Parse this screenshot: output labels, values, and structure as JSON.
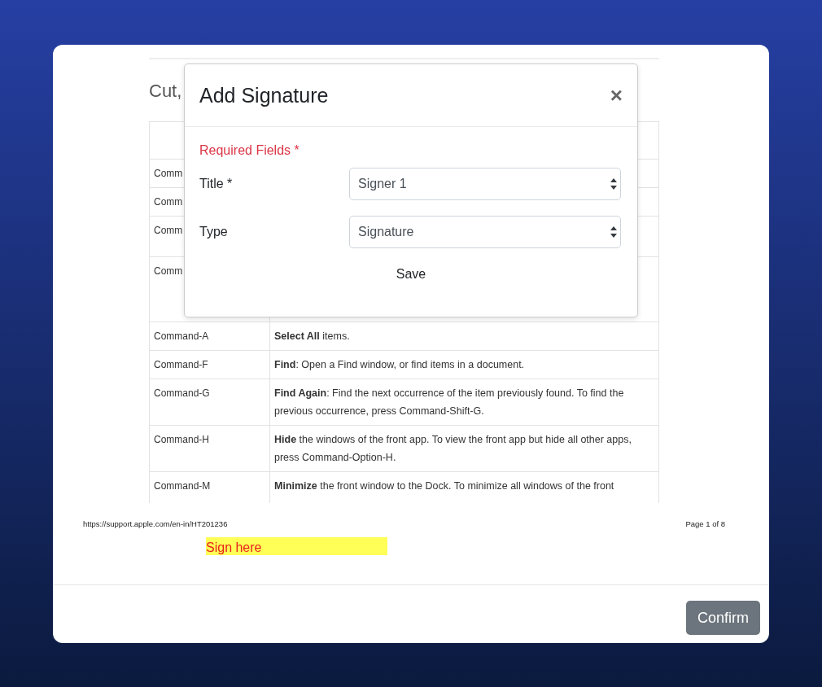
{
  "document": {
    "heading": "Cut,",
    "rows": [
      {
        "key": "Comm",
        "text": ""
      },
      {
        "key": "Comm",
        "text": ""
      },
      {
        "key": "Comm",
        "text": ""
      },
      {
        "key": "Comm",
        "text": ""
      },
      {
        "key": "Command-A",
        "text": "**Select All** items."
      },
      {
        "key": "Command-F",
        "text": "**Find**: Open a Find window, or find items in a document."
      },
      {
        "key": "Command-G",
        "text": "**Find Again**: Find the next occurrence of the item previously found. To find the previous occurrence, press Command-Shift-G."
      },
      {
        "key": "Command-H",
        "text": "**Hide** the windows of the front app. To view the front app but hide all other apps, press Command-Option-H."
      },
      {
        "key": "Command-M",
        "text": "**Minimize** the front window to the Dock. To minimize all windows of the front"
      }
    ],
    "footer_url": "https://support.apple.com/en-in/HT201236",
    "page": "Page 1 of 8"
  },
  "sign_here": "Sign here",
  "dialog": {
    "title": "Add Signature",
    "close": "×",
    "required_note": "Required Fields *",
    "fields": [
      {
        "label": "Title *",
        "value": "Signer 1"
      },
      {
        "label": "Type",
        "value": "Signature"
      }
    ],
    "save": "Save"
  },
  "confirm": "Confirm"
}
